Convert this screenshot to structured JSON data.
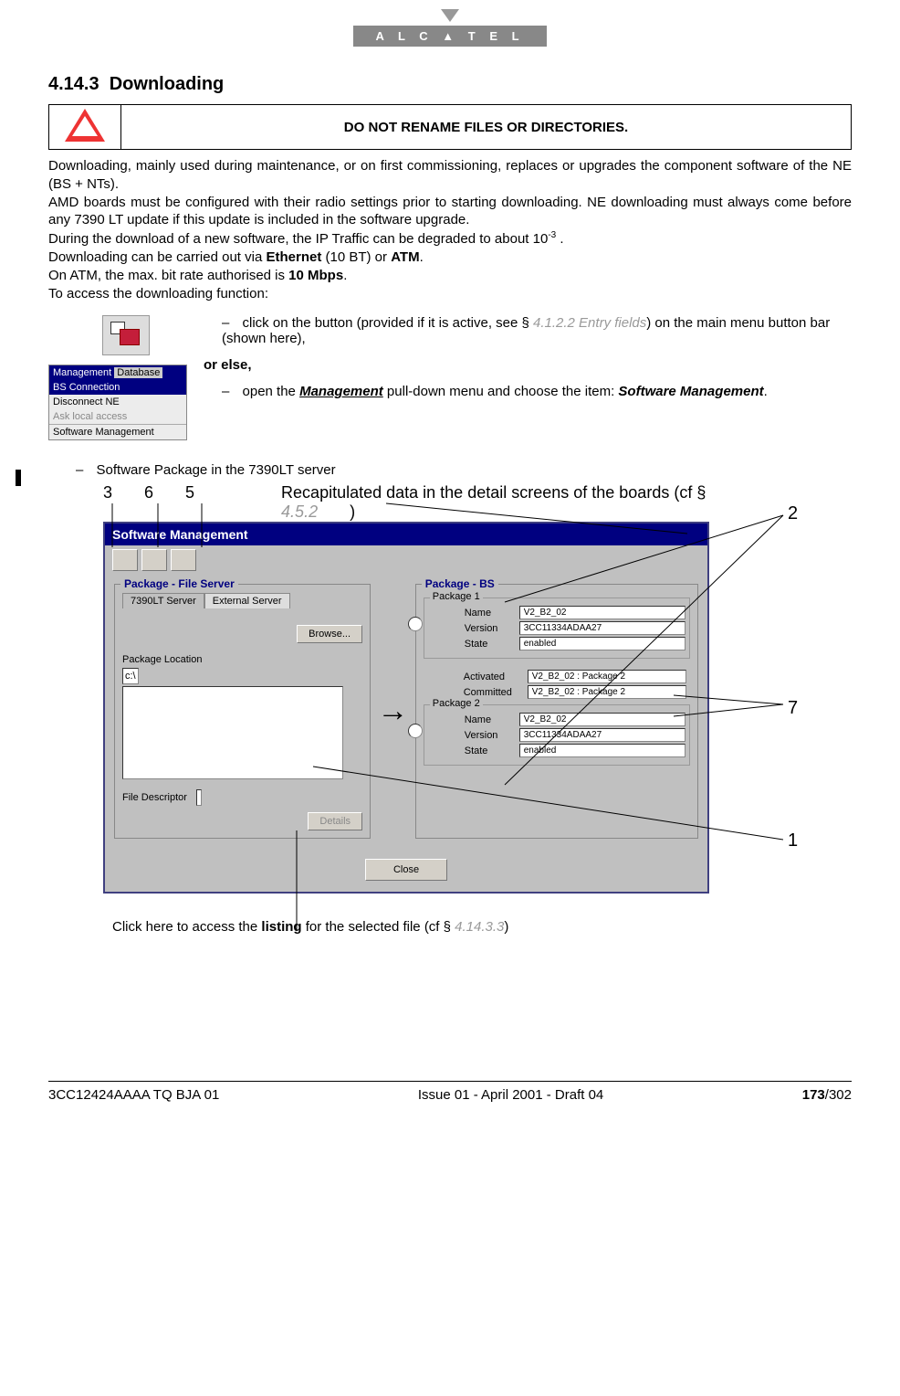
{
  "logo": {
    "text": "A L C ▲ T E L"
  },
  "section": {
    "number": "4.14.3",
    "title": "Downloading"
  },
  "warning": "DO NOT RENAME FILES OR DIRECTORIES.",
  "paragraphs": {
    "p1": "Downloading, mainly used during maintenance, or on first commissioning, replaces or upgrades the component software of the NE (BS + NTs).",
    "p2": "AMD boards must be configured with their radio settings prior to starting downloading. NE downloading must always come before any 7390 LT update if this update is included in the software upgrade.",
    "p3a": "During the download of a new software, the IP Traffic can be degraded to about 10",
    "p3sup": "-3",
    "p3b": " .",
    "p4a": "Downloading can be carried out via ",
    "p4b": "Ethernet",
    "p4c": " (10 BT) or ",
    "p4d": "ATM",
    "p4e": ".",
    "p5a": "On ATM, the max. bit rate authorised is ",
    "p5b": "10 Mbps",
    "p5c": ".",
    "p6": "To access the downloading function:"
  },
  "instructions": {
    "step1a": "click on the button (provided if it is active, see § ",
    "step1ref": "4.1.2.2 Entry fields",
    "step1b": ") on the main menu button bar (shown here),",
    "orelse": "or else,",
    "step2a": "open the ",
    "step2m": "Management",
    "step2b": " pull-down menu and choose the item: ",
    "step2s": "Software Management",
    "step2c": ".",
    "menu": {
      "bar1": "Management",
      "bar2": "Database",
      "i1": "BS Connection",
      "i2": "Disconnect NE",
      "i3": "Ask local access",
      "i4": "Software Management"
    }
  },
  "subsection": "Software Package in the 7390LT server",
  "callouts": {
    "c3": "3",
    "c6": "6",
    "c5": "5",
    "recap_a": "Recapitulated data in the detail screens of the boards (cf § ",
    "recap_ref": "4.5.2",
    "recap_b": ")",
    "c2": "2",
    "c7": "7",
    "c1": "1",
    "below_a": "Click here to access the ",
    "below_b": "listing",
    "below_c": " for the selected file (cf § ",
    "below_ref": "4.14.3.3",
    "below_d": ")"
  },
  "sw": {
    "title": "Software Management",
    "fs_title": "Package - File Server",
    "tab1": "7390LT Server",
    "tab2": "External Server",
    "browse": "Browse...",
    "pkg_loc": "Package Location",
    "path": "c:\\",
    "file_desc": "File Descriptor",
    "details": "Details",
    "bs_title": "Package - BS",
    "pk1": "Package 1",
    "pk2": "Package 2",
    "name_l": "Name",
    "ver_l": "Version",
    "state_l": "State",
    "act_l": "Activated",
    "com_l": "Committed",
    "name_v": "V2_B2_02",
    "ver_v": "3CC11334ADAA27",
    "state_v": "enabled",
    "act_v": "V2_B2_02 : Package 2",
    "com_v": "V2_B2_02 : Package 2",
    "close": "Close",
    "arrow": "→"
  },
  "footer": {
    "left": "3CC12424AAAA TQ BJA 01",
    "center": "Issue 01 - April 2001 - Draft 04",
    "right_bold": "173",
    "right_rest": "/302"
  }
}
